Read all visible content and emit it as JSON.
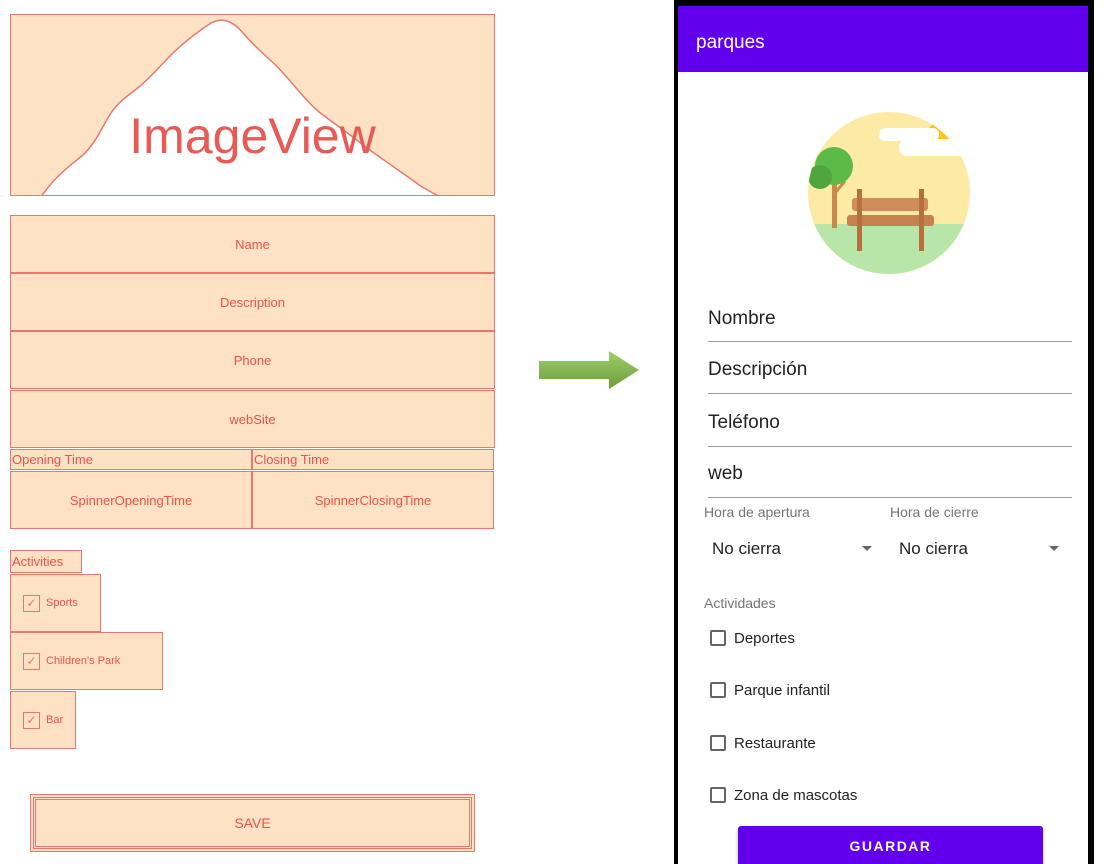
{
  "blueprint": {
    "imageview_label": "ImageView",
    "name_label": "Name",
    "description_label": "Description",
    "phone_label": "Phone",
    "website_label": "webSite",
    "opening_time_label": "Opening Time",
    "closing_time_label": "Closing Time",
    "spinner_opening_label": "SpinnerOpeningTime",
    "spinner_closing_label": "SpinnerClosingTime",
    "activities_label": "Activities",
    "checkboxes": [
      "Sports",
      "Children's Park",
      "Bar"
    ],
    "save_label": "SAVE"
  },
  "app": {
    "title": "parques",
    "accent_color": "#6200ee",
    "fields": {
      "nombre": "Nombre",
      "descripcion": "Descripción",
      "telefono": "Teléfono",
      "web": "web"
    },
    "opening_label": "Hora de apertura",
    "closing_label": "Hora de cierre",
    "opening_value": "No cierra",
    "closing_value": "No cierra",
    "activities_label": "Actividades",
    "checkboxes": [
      "Deportes",
      "Parque infantil",
      "Restaurante",
      "Zona de mascotas"
    ],
    "save_label": "GUARDAR"
  },
  "colors": {
    "blueprint_fill": "#ffe2c4",
    "blueprint_stroke": "#e8776f",
    "arrow": "#7db24a"
  }
}
